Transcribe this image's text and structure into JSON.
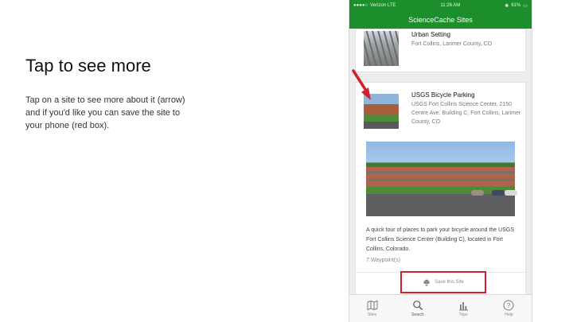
{
  "slide": {
    "title": "Tap to see more",
    "body": "Tap on a site to see more about it (arrow) and if you'd like you can save the site to your phone (red box)."
  },
  "phone": {
    "status_bar": {
      "carrier": "Verizon LTE",
      "time": "11:26 AM",
      "battery": "61%"
    },
    "nav_title": "ScienceCache Sites",
    "sites": [
      {
        "title": "Urban Setting",
        "subtitle": "Fort Collins, Larimer County, CO"
      },
      {
        "title": "USGS Bicycle Parking",
        "subtitle": "USGS Fort Collins Science Center, 2150 Centre Ave. Building C, Fort Collins, Larimer County, CO",
        "description": "A quick tour of places to park your bicycle around the USGS Fort Collins Science Center (Building C), located in Fort Collins, Colorado.",
        "waypoints": "7 Waypoint(s)",
        "save_label": "Save this Site"
      }
    ],
    "tabs": [
      {
        "label": "Sites",
        "icon": "map-icon"
      },
      {
        "label": "Search",
        "icon": "search-icon"
      },
      {
        "label": "Trips",
        "icon": "bar-chart-icon"
      },
      {
        "label": "Help",
        "icon": "question-icon"
      }
    ]
  },
  "colors": {
    "nav_green": "#1c8f2c",
    "highlight_red": "#d0212a"
  }
}
